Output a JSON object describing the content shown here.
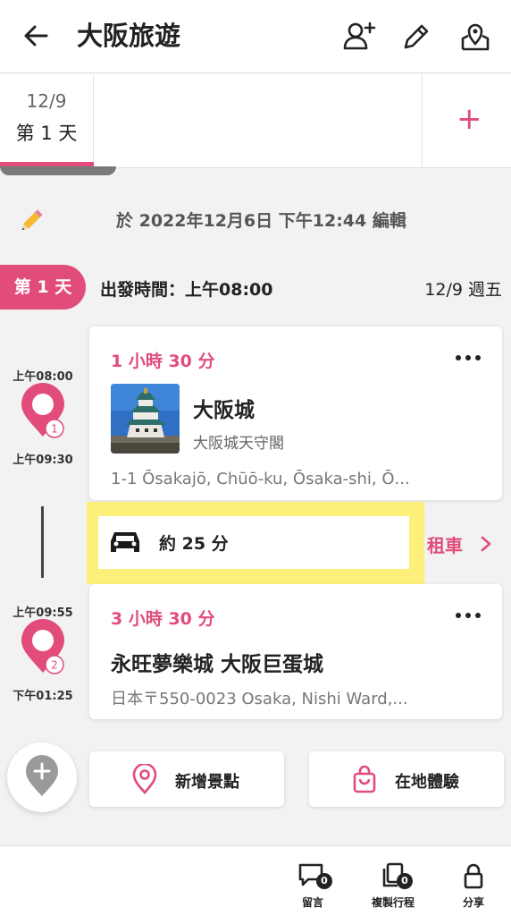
{
  "header": {
    "title": "大阪旅遊",
    "icons": [
      "back-arrow-icon",
      "add-person-icon",
      "pencil-icon",
      "map-pin-icon"
    ]
  },
  "day_tabs": {
    "active": {
      "date": "12/9",
      "label": "第 1 天"
    },
    "add_label": "+"
  },
  "edit_info": {
    "text": "於 2022年12月6日 下午12:44 編輯"
  },
  "day_header": {
    "pill": "第 1 天",
    "departure": "出發時間：上午08:00",
    "date": "12/9 週五"
  },
  "stops": [
    {
      "number": "1",
      "start": "上午08:00",
      "end": "上午09:30",
      "duration": "1 小時 30 分",
      "name": "大阪城",
      "subtitle": "大阪城天守閣",
      "address": "1-1 Ōsakajō, Chūō-ku, Ōsaka-shi, Ō..."
    },
    {
      "number": "2",
      "start": "上午09:55",
      "end": "下午01:25",
      "duration": "3 小時 30 分",
      "name": "永旺夢樂城 大阪巨蛋城",
      "address": "日本〒550-0023 Osaka, Nishi Ward,..."
    }
  ],
  "travel": {
    "mode_icon": "car-icon",
    "time": "約 25 分",
    "rent_label": "租車"
  },
  "actions": {
    "add_spot": "新增景點",
    "local_experience": "在地體驗"
  },
  "bottom_nav": {
    "comment": {
      "label": "留言",
      "count": "0"
    },
    "copy": {
      "label": "複製行程",
      "count": "0"
    },
    "share": {
      "label": "分享"
    }
  },
  "colors": {
    "accent": "#e24c7b",
    "highlight": "#fdf07a"
  }
}
